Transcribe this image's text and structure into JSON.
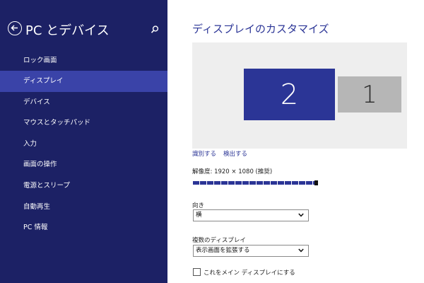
{
  "sidebar": {
    "title": "PC とデバイス",
    "items": [
      {
        "label": "ロック画面",
        "selected": false
      },
      {
        "label": "ディスプレイ",
        "selected": true
      },
      {
        "label": "デバイス",
        "selected": false
      },
      {
        "label": "マウスとタッチパッド",
        "selected": false
      },
      {
        "label": "入力",
        "selected": false
      },
      {
        "label": "画面の操作",
        "selected": false
      },
      {
        "label": "電源とスリープ",
        "selected": false
      },
      {
        "label": "自動再生",
        "selected": false
      },
      {
        "label": "PC 情報",
        "selected": false
      }
    ],
    "back_icon": "back-arrow-icon",
    "search_icon": "search-icon"
  },
  "main": {
    "title": "ディスプレイのカスタマイズ",
    "monitors": [
      {
        "number": "2",
        "selected": true
      },
      {
        "number": "1",
        "selected": false
      }
    ],
    "identify_link": "識別する",
    "detect_link": "検出する",
    "resolution_label": "解像度: 1920 × 1080 (推奨)",
    "resolution_slider_value": 1.0,
    "orientation": {
      "label": "向き",
      "value": "横"
    },
    "multiple_displays": {
      "label": "複数のディスプレイ",
      "value": "表示画面を拡張する"
    },
    "main_display_checkbox": {
      "label": "これをメイン ディスプレイにする",
      "checked": false
    }
  },
  "colors": {
    "sidebar_bg": "#1c2165",
    "selected_item": "#3a43a8",
    "accent": "#2b3596",
    "secondary_monitor": "#b6b6b6"
  }
}
